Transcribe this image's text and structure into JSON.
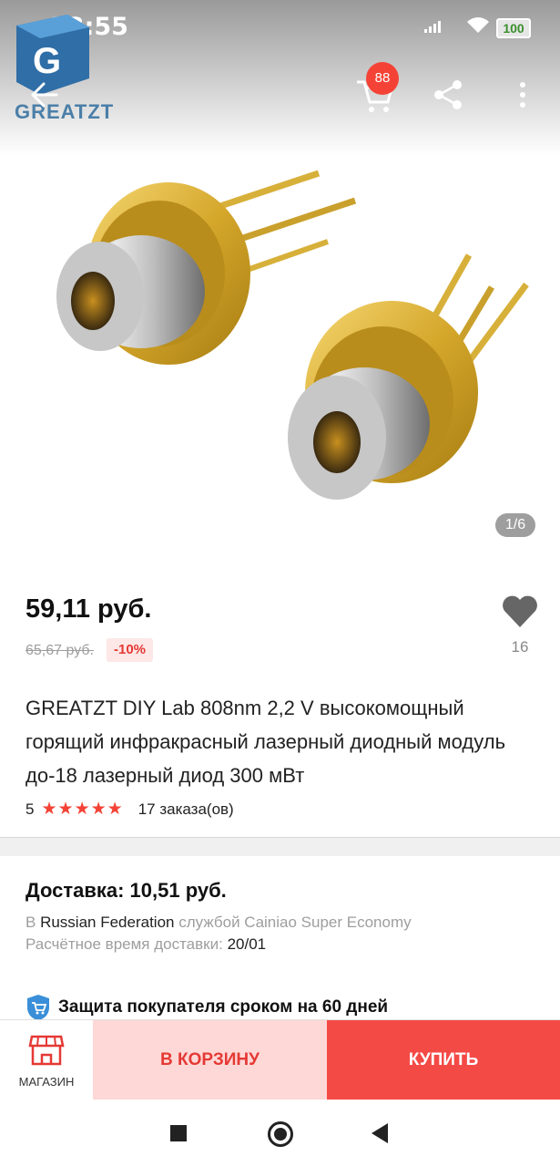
{
  "status_bar": {
    "time": "23:55",
    "battery": "100"
  },
  "brand": {
    "logo_text": "GREATZT"
  },
  "header": {
    "cart_count": "88"
  },
  "gallery": {
    "counter": "1/6"
  },
  "product": {
    "price": "59,11 руб.",
    "old_price": "65,67 руб.",
    "discount": "-10%",
    "wishlist_count": "16",
    "title": "GREATZT DIY Lab 808nm 2,2 V высокомощный горящий инфракрасный лазерный диодный модуль до-18 лазерный диод 300 мВт",
    "rating": "5",
    "stars": 5,
    "orders": "17 заказа(ов)"
  },
  "shipping": {
    "title": "Доставка: 10,51 руб.",
    "prefix": "В ",
    "country": "Russian Federation",
    "service": " службой Cainiao Super Economy",
    "eta_label": "Расчётное время доставки: ",
    "eta_value": "20/01"
  },
  "protection": {
    "text": "Защита покупателя сроком на 60 дней"
  },
  "bottom_bar": {
    "store_label": "МАГАЗИН",
    "add_to_cart": "В КОРЗИНУ",
    "buy": "КУПИТЬ"
  },
  "colors": {
    "accent_red": "#f44a46",
    "cart_btn_bg": "#fdd8d6",
    "discount_bg": "#fde7e7",
    "badge": "#f44336",
    "star": "#f44336"
  },
  "icons": [
    "back-arrow-icon",
    "cart-icon",
    "share-icon",
    "more-vert-icon",
    "heart-icon",
    "star-icon",
    "shield-cart-icon",
    "store-icon",
    "nav-recents-icon",
    "nav-home-icon",
    "nav-back-icon"
  ]
}
